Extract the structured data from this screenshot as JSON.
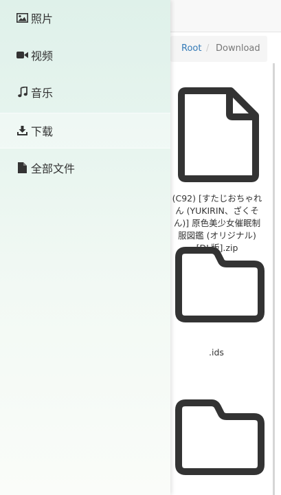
{
  "drawer": {
    "items": [
      {
        "label": "照片",
        "icon": "image-icon"
      },
      {
        "label": "视频",
        "icon": "video-camera-icon"
      },
      {
        "label": "音乐",
        "icon": "music-note-icon"
      },
      {
        "label": "下载",
        "icon": "download-icon",
        "active": true
      },
      {
        "label": "全部文件",
        "icon": "file-icon"
      }
    ]
  },
  "breadcrumb": {
    "root": "Root",
    "separator": "/",
    "current": "Download"
  },
  "files": {
    "zip": {
      "name_lines": [
        "(C92) [すたじおちゃれ",
        "ん (YUKIRIN、ざくそ",
        "ん)] 原色美少女催眠制",
        "服図鑑 (オリジナル)",
        "[DL版].zip"
      ],
      "icon": "document-icon"
    },
    "folder1": {
      "name": ".ids",
      "icon": "folder-icon"
    },
    "folder2": {
      "icon": "folder-icon"
    }
  },
  "colors": {
    "link": "#337ab7",
    "icon_stroke": "#333333"
  }
}
